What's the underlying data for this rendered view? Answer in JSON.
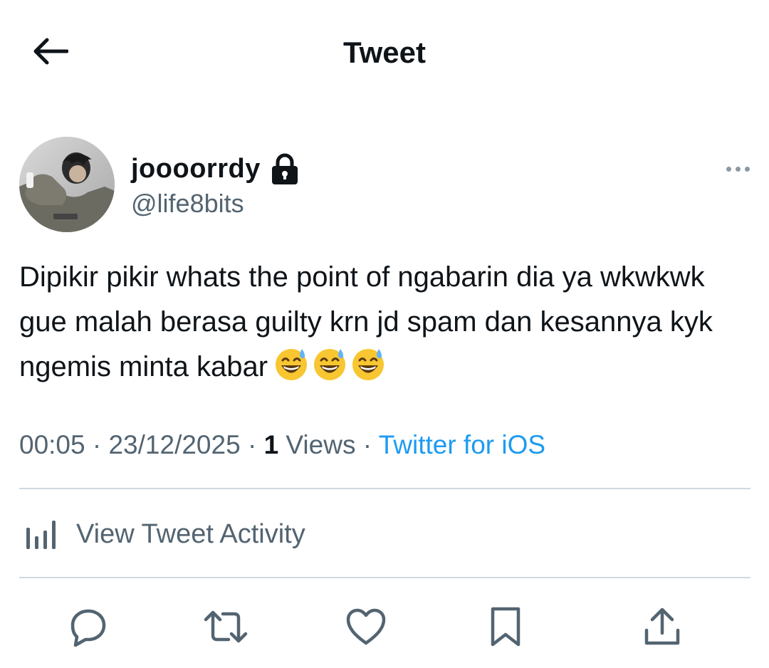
{
  "header": {
    "title": "Tweet",
    "back_icon": "arrow-left-icon"
  },
  "author": {
    "display_name": "joooorrdy",
    "handle": "@life8bits",
    "protected_icon": "lock-icon",
    "avatar": "profile-photo"
  },
  "tweet": {
    "text": "Dipikir pikir whats the point of ngabarin dia ya wkwkwk gue malah berasa guilty krn jd spam dan kesannya kyk ngemis minta kabar",
    "emojis": [
      "grinning-face-with-sweat",
      "grinning-face-with-sweat",
      "grinning-face-with-sweat"
    ],
    "time": "00:05",
    "separator": "·",
    "date": "23/12/2025",
    "views_count": "1",
    "views_label": "Views",
    "source": "Twitter for iOS"
  },
  "activity": {
    "label": "View Tweet Activity",
    "icon": "bar-chart-icon"
  },
  "actions": [
    {
      "name": "reply",
      "icon": "reply-icon"
    },
    {
      "name": "retweet",
      "icon": "retweet-icon"
    },
    {
      "name": "like",
      "icon": "heart-icon"
    },
    {
      "name": "bookmark",
      "icon": "bookmark-icon"
    },
    {
      "name": "share",
      "icon": "share-icon"
    }
  ],
  "colors": {
    "text_primary": "#0f1419",
    "text_secondary": "#536471",
    "accent": "#1d9bf0",
    "divider": "#cfd9de",
    "emoji_face": "#f7c631"
  }
}
